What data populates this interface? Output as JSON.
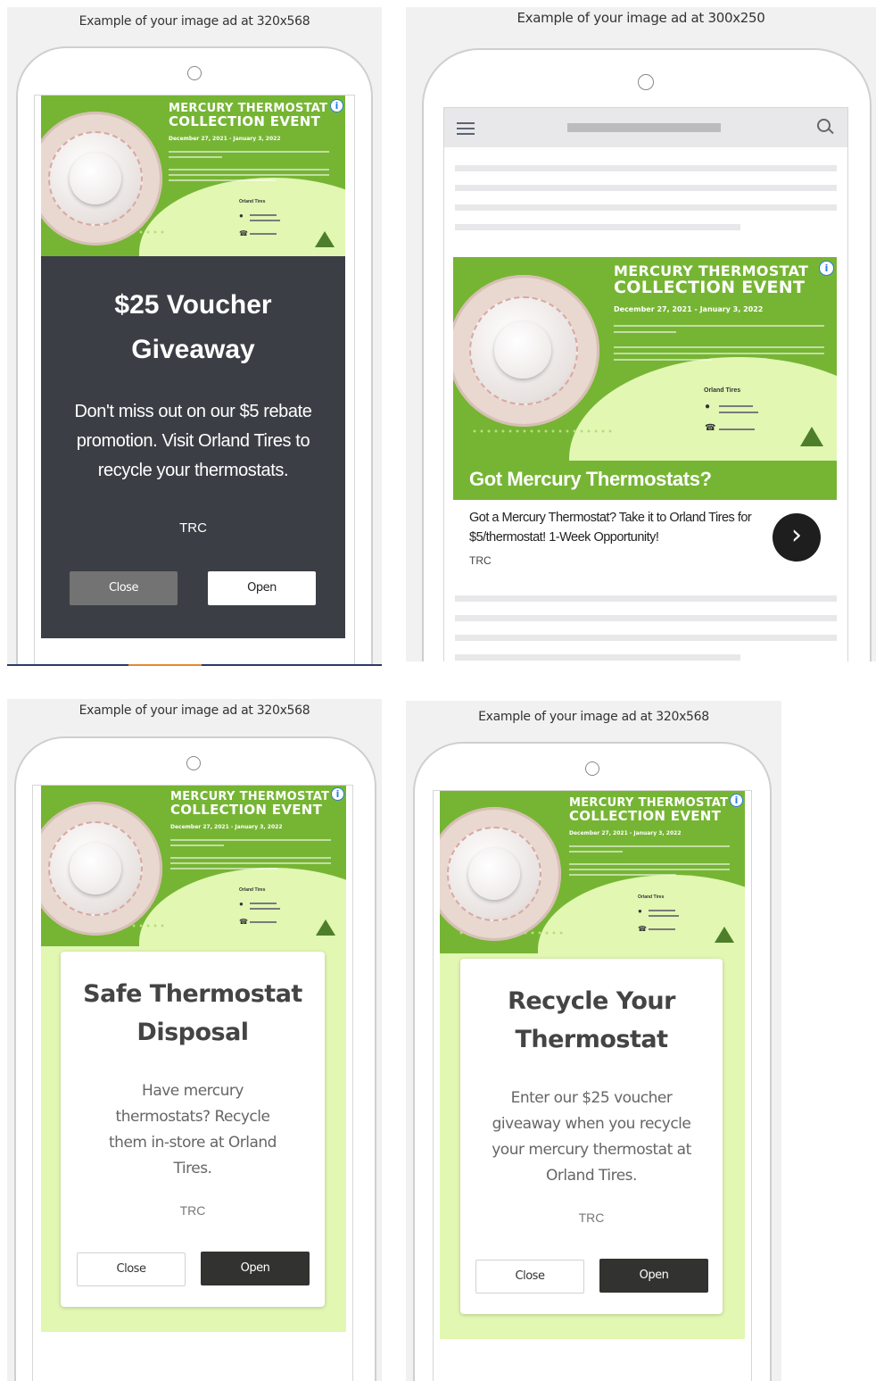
{
  "ad": {
    "title_line1": "MERCURY THERMOSTAT",
    "title_line2": "COLLECTION EVENT",
    "date": "December 27, 2021 - January 3, 2022",
    "store": "Orland Tires",
    "info_icon": "info-icon",
    "brand_color": "#76b534",
    "light_green": "#e1f7b2"
  },
  "panels": [
    {
      "caption": "Example of your image ad at 320x568",
      "headline": "$25 Voucher Giveaway",
      "description": "Don't miss out on our $5 rebate promotion. Visit Orland Tires to recycle your thermostats.",
      "advertiser": "TRC",
      "close_label": "Close",
      "open_label": "Open"
    },
    {
      "caption": "Example of your image ad at 300x250",
      "headline": "Got Mercury Thermostats?",
      "description": "Got a Mercury Thermostat? Take it to Orland Tires for $5/thermostat! 1-Week Opportunity!",
      "advertiser": "TRC",
      "menu_icon": "hamburger-menu-icon",
      "search_icon": "search-icon",
      "arrow_icon": "chevron-right-icon"
    },
    {
      "caption": "Example of your image ad at 320x568",
      "headline": "Safe Thermostat Disposal",
      "description": "Have mercury thermostats? Recycle them in-store at Orland Tires.",
      "advertiser": "TRC",
      "close_label": "Close",
      "open_label": "Open"
    },
    {
      "caption": "Example of your image ad at 320x568",
      "headline": "Recycle Your Thermostat",
      "description": "Enter our $25 voucher giveaway when you recycle your mercury thermostat at Orland Tires.",
      "advertiser": "TRC",
      "close_label": "Close",
      "open_label": "Open"
    }
  ]
}
